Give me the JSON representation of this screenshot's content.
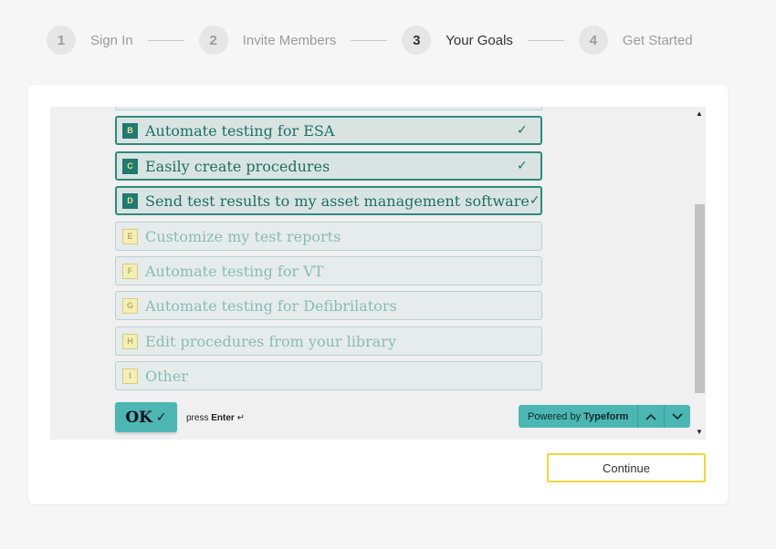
{
  "stepper": {
    "steps": [
      {
        "number": "1",
        "label": "Sign In"
      },
      {
        "number": "2",
        "label": "Invite Members"
      },
      {
        "number": "3",
        "label": "Your Goals"
      },
      {
        "number": "4",
        "label": "Get Started"
      }
    ],
    "active_step": 3
  },
  "typeform": {
    "options": [
      {
        "key": "B",
        "label": "Automate testing for ESA",
        "selected": true
      },
      {
        "key": "C",
        "label": "Easily create procedures",
        "selected": true
      },
      {
        "key": "D",
        "label": "Send test results to my asset management software",
        "selected": true
      },
      {
        "key": "E",
        "label": "Customize my test reports",
        "selected": false
      },
      {
        "key": "F",
        "label": "Automate testing for VT",
        "selected": false
      },
      {
        "key": "G",
        "label": "Automate testing for Defibrilators",
        "selected": false
      },
      {
        "key": "H",
        "label": "Edit procedures from your library",
        "selected": false
      },
      {
        "key": "I",
        "label": "Other",
        "selected": false
      }
    ],
    "ok_label": "OK",
    "press_prefix": "press",
    "press_key": "Enter",
    "press_symbol": "↵",
    "powered_prefix": "Powered by",
    "powered_brand": "Typeform"
  },
  "continue_label": "Continue",
  "icons": {
    "check": "check-icon",
    "chevron_up": "chevron-up-icon",
    "chevron_down": "chevron-down-icon"
  },
  "colors": {
    "accent": "#4cb7b2",
    "selected_text": "#1d6f65",
    "continue_border": "#f2d53c"
  }
}
